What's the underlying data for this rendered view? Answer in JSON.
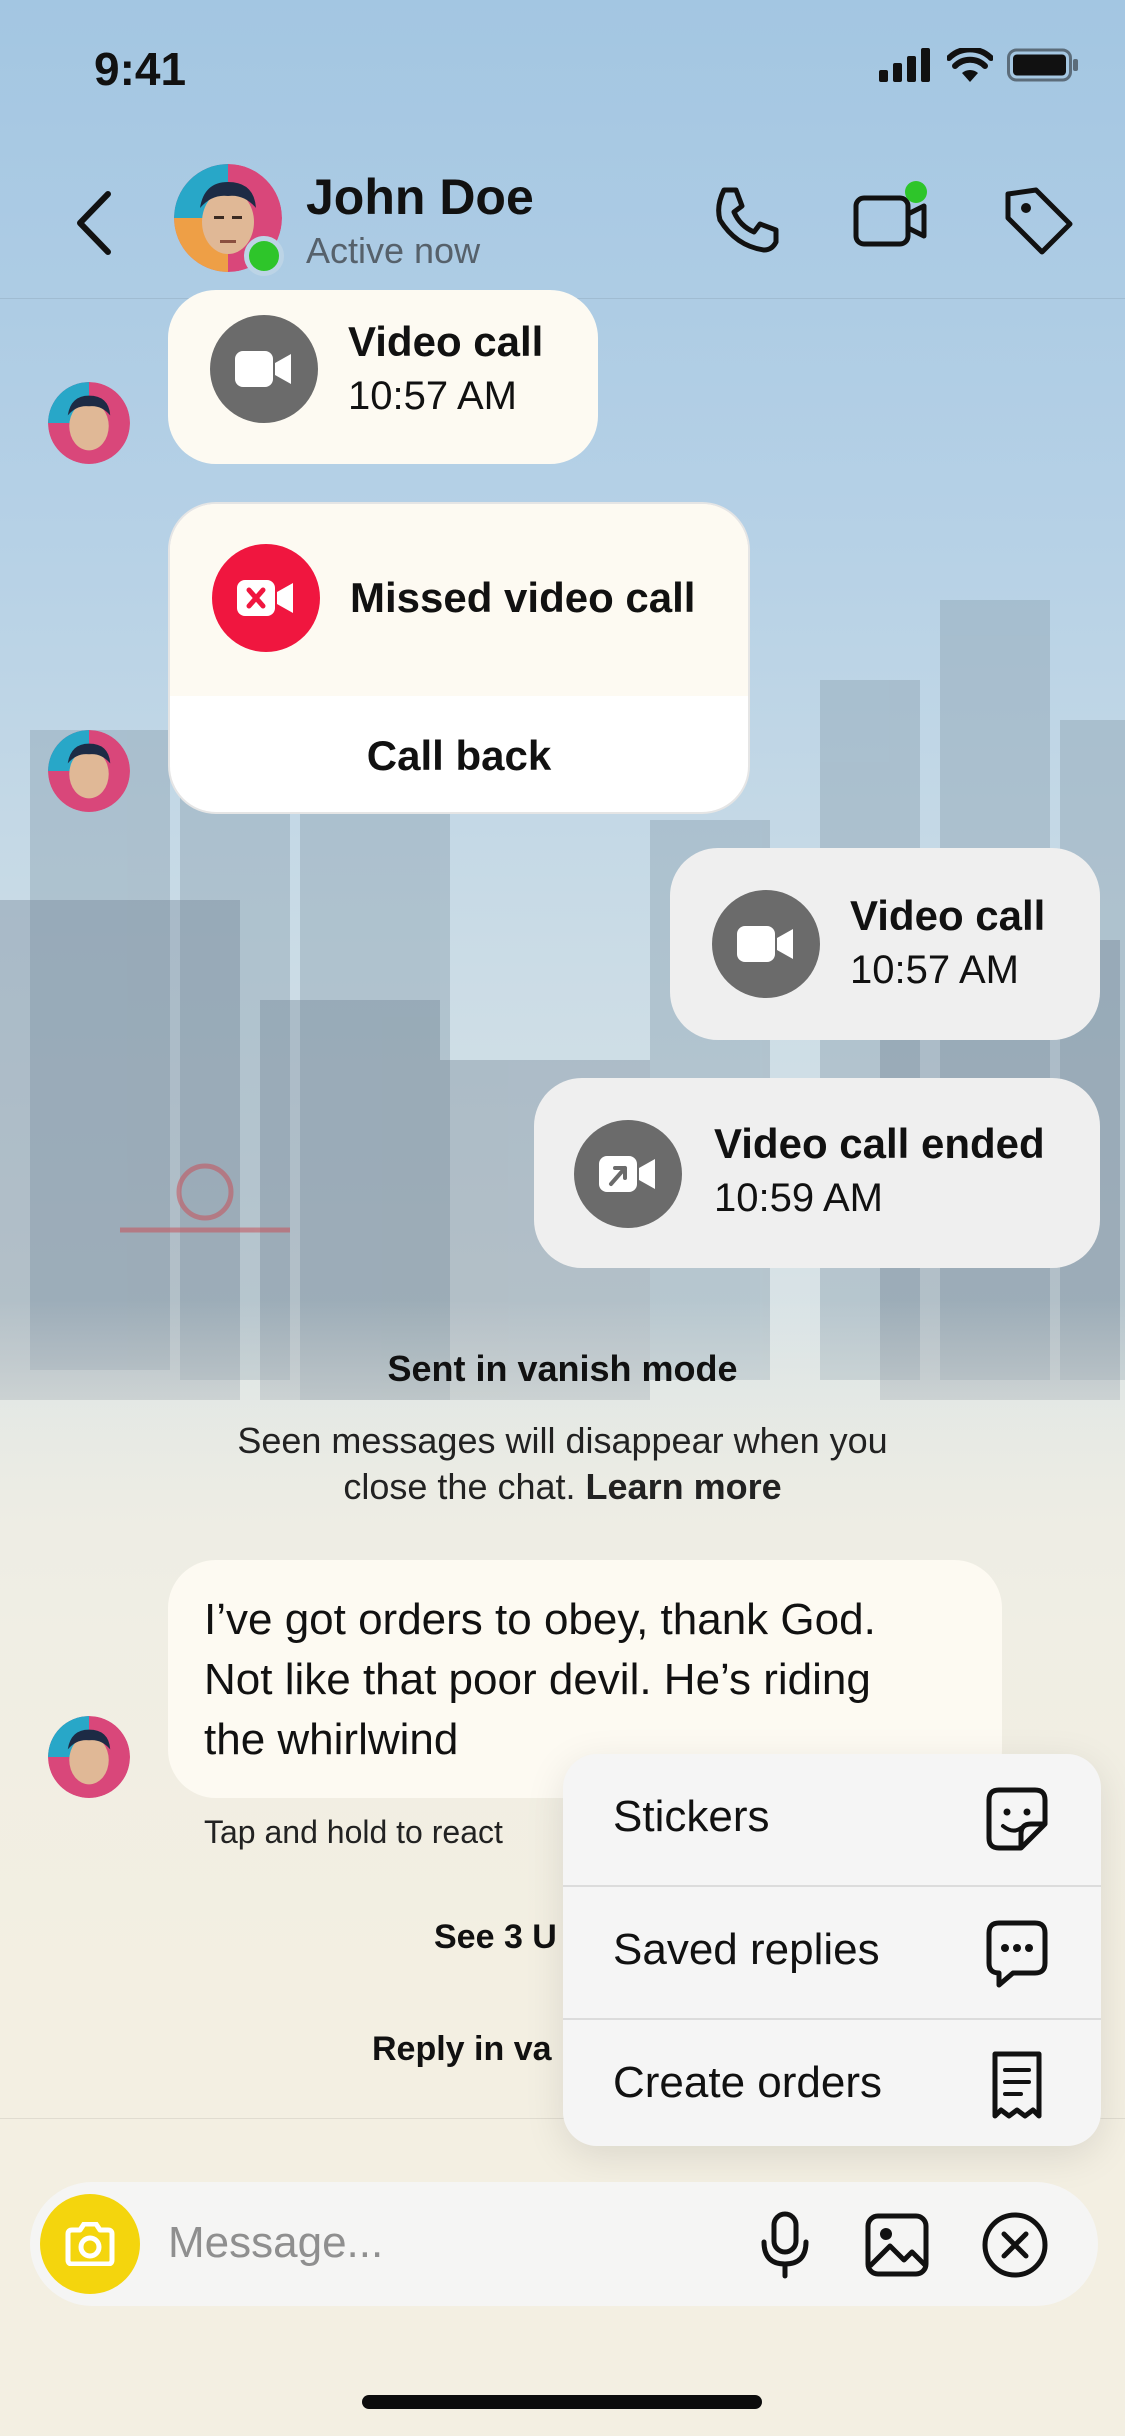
{
  "status_bar": {
    "time": "9:41"
  },
  "header": {
    "contact_name": "John Doe",
    "presence": "Active now"
  },
  "messages": {
    "incoming_call": {
      "title": "Video call",
      "time": "10:57 AM"
    },
    "missed_call": {
      "title": "Missed video call",
      "action": "Call back"
    },
    "outgoing_call": {
      "title": "Video call",
      "time": "10:57 AM"
    },
    "call_ended": {
      "title": "Video call ended",
      "time": "10:59 AM"
    }
  },
  "vanish_notice": {
    "heading": "Sent in vanish mode",
    "line1": "Seen messages will disappear when you",
    "line2_prefix": "close the chat.",
    "link": "Learn more"
  },
  "text_message": {
    "line1": "I’ve got orders to obey, thank God.",
    "line2": "Not like that poor devil. He’s riding",
    "line3": "the whirlwind",
    "hint": "Tap and hold to react"
  },
  "footer_links": {
    "see_partial": "See 3 U",
    "reply_partial": "Reply in va"
  },
  "menu": {
    "items": [
      {
        "label": "Stickers",
        "icon": "sticker-icon"
      },
      {
        "label": "Saved replies",
        "icon": "chat-bubble-icon"
      },
      {
        "label": "Create orders",
        "icon": "receipt-icon"
      }
    ]
  },
  "composer": {
    "placeholder": "Message..."
  },
  "colors": {
    "accent_yellow": "#f4d50d",
    "missed_red": "#f0163f",
    "online_green": "#2ec52a",
    "call_icon_grey": "#6b6b6b"
  }
}
